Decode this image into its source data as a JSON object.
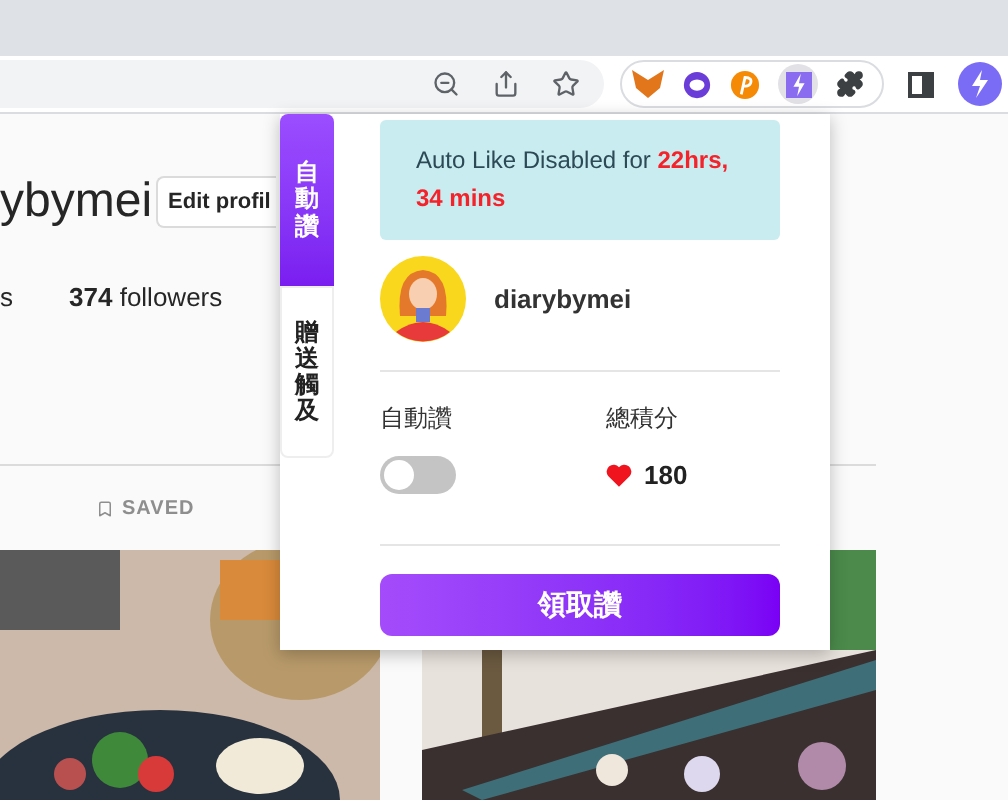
{
  "profile": {
    "username": "ybymei",
    "edit_button": "Edit profil",
    "stats": [
      {
        "label": "s"
      },
      {
        "count": "374",
        "label": "followers"
      }
    ],
    "saved_tab": "SAVED"
  },
  "extension_popup": {
    "tabs": [
      {
        "label": "自動讚",
        "selected": true
      },
      {
        "label": "贈送觸及",
        "selected": false
      }
    ],
    "alert": {
      "text": "Auto Like Disabled for ",
      "highlight": "22hrs, 34 mins"
    },
    "account": {
      "name": "diarybymei"
    },
    "auto_like": {
      "label": "自動讚",
      "on": false
    },
    "points": {
      "label": "總積分",
      "value": "180"
    },
    "claim_button": "領取讚"
  }
}
